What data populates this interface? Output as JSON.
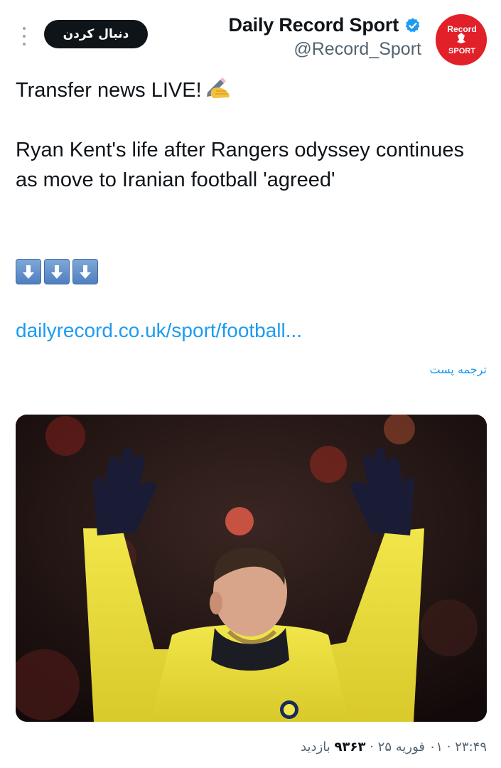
{
  "header": {
    "follow_label": "دنبال کردن",
    "author_name": "Daily Record Sport",
    "author_handle": "@Record_Sport",
    "avatar_logo_text": "Record SPORT",
    "more_icon": "more-vertical-icon",
    "verified_icon": "verified-badge-icon"
  },
  "tweet": {
    "line1": "Transfer news LIVE!",
    "emoji_name": "writing-hand-emoji",
    "headline": "Ryan Kent's life after Rangers odyssey continues as move to Iranian football 'agreed'",
    "arrows": [
      "down-arrow-emoji",
      "down-arrow-emoji",
      "down-arrow-emoji"
    ],
    "link": "dailyrecord.co.uk/sport/football...",
    "translate_label": "ترجمه پست"
  },
  "media": {
    "description_icon": "football-player-photo"
  },
  "meta": {
    "time": "۲۳:۴۹",
    "date": "۰۱ فوریه ۲۵",
    "views_count": "۹۳۶۳",
    "views_label": "بازدید",
    "separator": "·"
  },
  "colors": {
    "link": "#1d9bf0",
    "text": "#0f1419",
    "secondary": "#536471",
    "verified": "#1d9bf0",
    "avatar_bg": "#e2202a"
  }
}
